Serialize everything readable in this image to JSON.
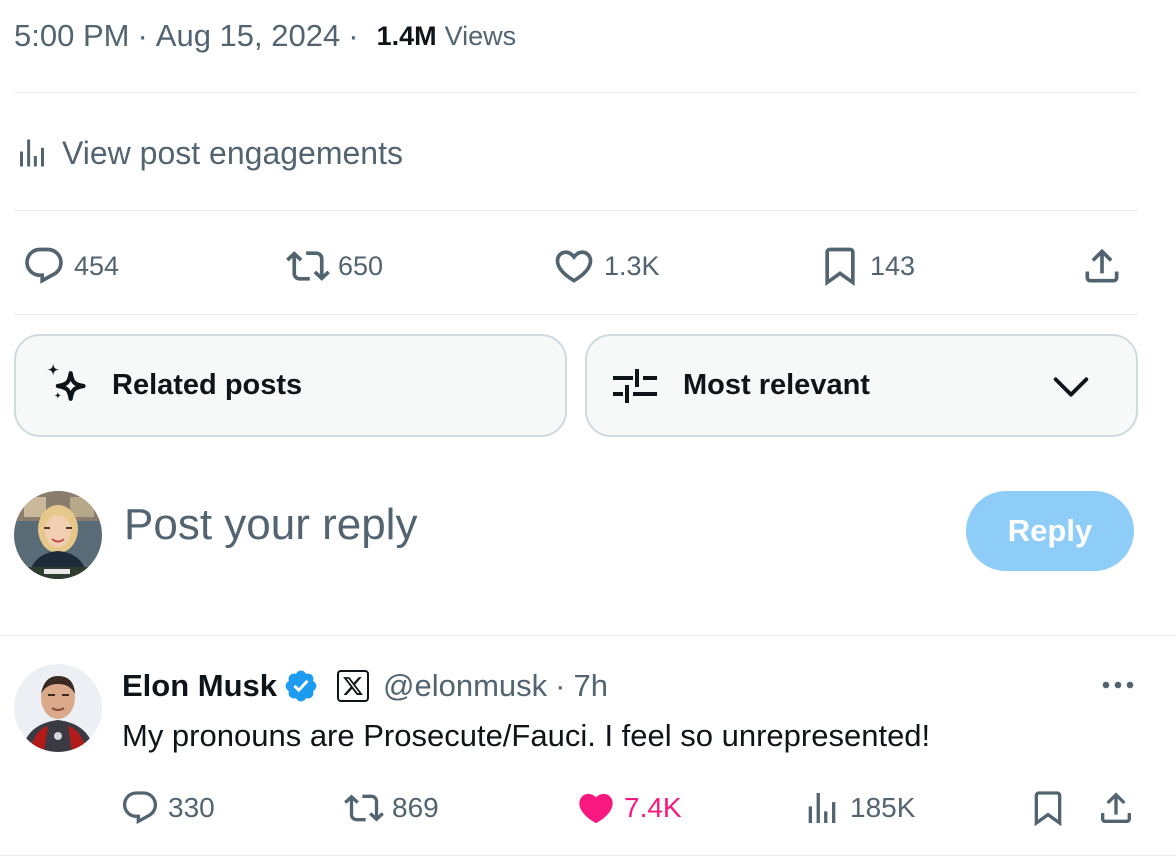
{
  "post_meta": {
    "time": "5:00 PM",
    "separator": "·",
    "date": "Aug 15, 2024",
    "views_count": "1.4M",
    "views_label": "Views"
  },
  "engagements": {
    "icon": "analytics-icon",
    "label": "View post engagements"
  },
  "actions": {
    "replies": "454",
    "reposts": "650",
    "likes": "1.3K",
    "bookmarks": "143"
  },
  "related_posts": {
    "icon": "sparkle-icon",
    "label": "Related posts"
  },
  "sort": {
    "icon": "sliders-icon",
    "selected": "Most relevant",
    "chevron": "chevron-down-icon"
  },
  "compose": {
    "placeholder": "Post your reply",
    "button": "Reply"
  },
  "reply": {
    "author_name": "Elon Musk",
    "handle": "@elonmusk",
    "separator": "·",
    "time": "7h",
    "text": "My pronouns are Prosecute/Fauci. I feel so unrepresented!",
    "stats": {
      "replies": "330",
      "reposts": "869",
      "likes": "7.4K",
      "views": "185K"
    }
  },
  "colors": {
    "text_primary": "#0f1419",
    "text_secondary": "#536471",
    "accent_blue": "#1d9bf0",
    "reply_button_disabled": "#8ecdf8",
    "like_active": "#f91880",
    "border": "#cfd9de"
  }
}
